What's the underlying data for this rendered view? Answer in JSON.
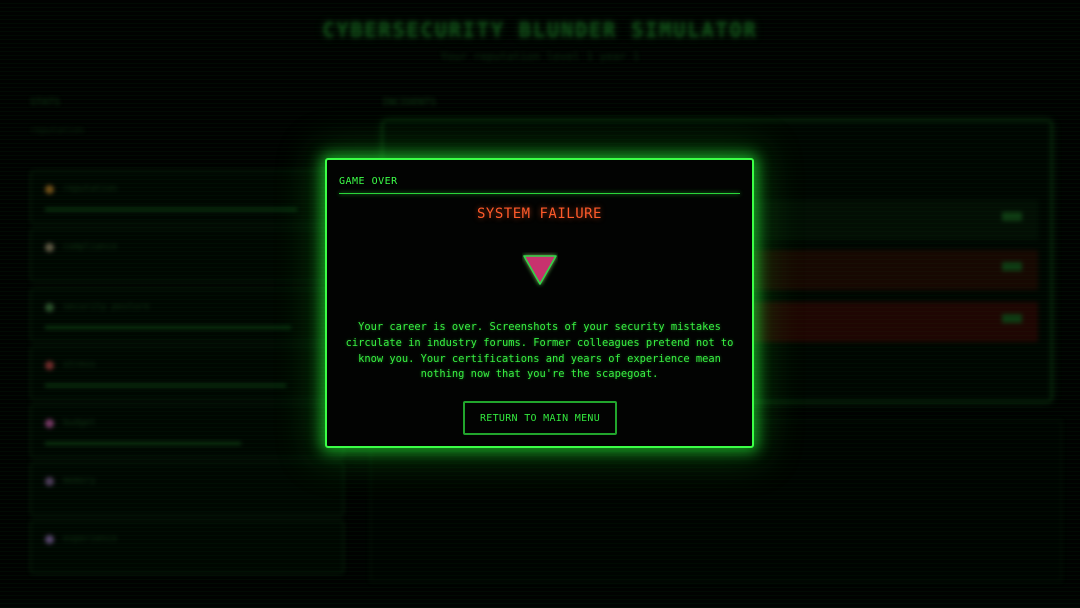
{
  "background": {
    "title": "CYBERSECURITY BLUNDER SIMULATOR",
    "subtitle": "Your reputation level 1 year 1",
    "left_heading": "STATS",
    "left_subheading": "reputation",
    "right_heading": "INCIDENTS",
    "cards": [
      {
        "label": "reputation",
        "dot_color": "#c88a2a",
        "bar": 0.9
      },
      {
        "label": "compliance",
        "dot_color": "#a89a78",
        "bar": 0.0
      },
      {
        "label": "security posture",
        "dot_color": "#4a8a4a",
        "bar": 0.88
      },
      {
        "label": "stress",
        "dot_color": "#c84a4a",
        "bar": 0.86
      },
      {
        "label": "budget",
        "dot_color": "#d060b0",
        "bar": 0.7
      },
      {
        "label": "memory",
        "dot_color": "#8a6aa0",
        "bar": 0.0
      },
      {
        "label": "experience",
        "dot_color": "#9a7ac0",
        "bar": 0.0
      }
    ]
  },
  "modal": {
    "header": "GAME OVER",
    "title": "SYSTEM FAILURE",
    "icon": "failure-triangle-icon",
    "icon_color": "#c8326e",
    "body": "Your career is over. Screenshots of your security mistakes circulate in industry forums. Former colleagues pretend not to know you. Your certifications and years of experience mean nothing now that you're the scapegoat.",
    "button_label": "RETURN TO MAIN MENU"
  },
  "colors": {
    "accent": "#3bff46",
    "title_alert": "#ff5a2a",
    "text": "#38f042"
  }
}
